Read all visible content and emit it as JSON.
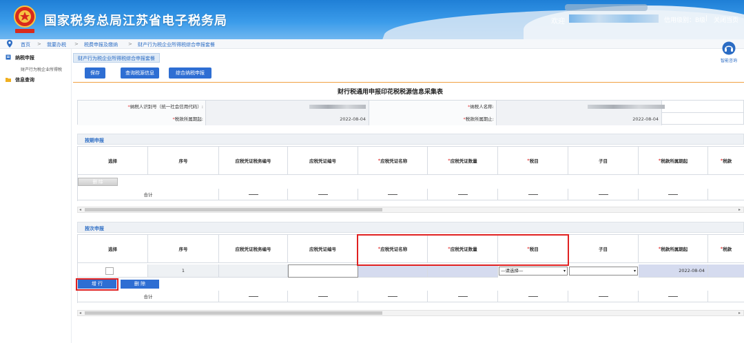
{
  "header": {
    "title": "国家税务总局江苏省电子税务局",
    "welcome": "欢迎",
    "grade": "信用级别：B级",
    "separator": "|",
    "close": "关闭当页"
  },
  "breadcrumb": [
    "首页",
    "我要办税",
    "税费申报及缴纳",
    "财产行为税企业所得税综合申报套餐"
  ],
  "breadcrumb_sep": ">",
  "help": {
    "label": "智能咨询"
  },
  "sidebar": {
    "items": [
      {
        "label": "纳税申报",
        "sub": "财产行为税企业所得税"
      },
      {
        "label": "信息查询"
      }
    ]
  },
  "tab": {
    "label": "财产行为税企业所得税综合申报套餐"
  },
  "toolbar": {
    "save": "保存",
    "query": "查询税源信息",
    "combined": "综合纳税申报"
  },
  "form": {
    "title": "财行税通用申报印花税税源信息采集表",
    "taxpayer_id_label": "纳税人识别号（统一社会信用代码）:",
    "taxpayer_name_label": "纳税人名称:",
    "period_start_label": "税款所属期起:",
    "period_start_value": "2022-08-04",
    "period_end_label": "税款所属期止:",
    "period_end_value": "2022-08-04",
    "required_mark": "*"
  },
  "sections": {
    "periodic": {
      "title": "按期申报",
      "delete": "删 除",
      "total": "合计"
    },
    "per_item": {
      "title": "按次申报",
      "row_seq": "1",
      "select_placeholder": "—请选择—",
      "date": "2022-08-04",
      "add": "增 行",
      "delete": "删 除",
      "total": "合计"
    }
  },
  "columns": [
    {
      "label": "选择",
      "required": false
    },
    {
      "label": "序号",
      "required": false
    },
    {
      "label": "应税凭证税务编号",
      "required": false
    },
    {
      "label": "应税凭证编号",
      "required": false
    },
    {
      "label": "应税凭证名称",
      "required": true
    },
    {
      "label": "应税凭证数量",
      "required": true
    },
    {
      "label": "税目",
      "required": true
    },
    {
      "label": "子目",
      "required": false
    },
    {
      "label": "税款所属期起",
      "required": true
    },
    {
      "label": "税款",
      "required": true
    }
  ],
  "colors": {
    "header_blue": "#1f7fd6",
    "button_blue": "#2e6ed3",
    "link_blue": "#2b6cc4",
    "highlight_red": "#e02020",
    "required_red": "#e23a3a",
    "accent_orange": "#f0a040"
  },
  "icons": [
    "emblem-logo",
    "location-pin-icon",
    "headset-icon",
    "doc-icon",
    "folder-icon",
    "chevron-down-icon"
  ]
}
